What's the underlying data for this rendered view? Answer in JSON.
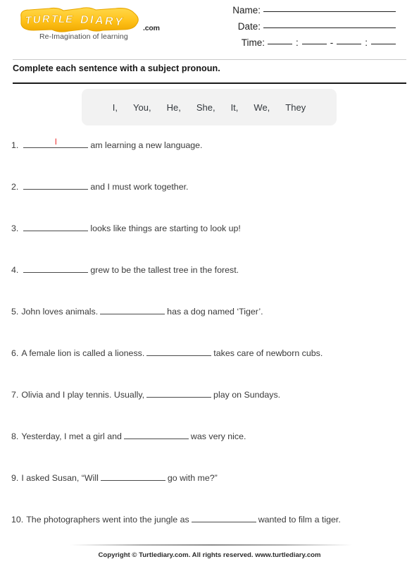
{
  "brand": {
    "logo_text": "TURTLE DIARY",
    "logo_word_1": "TURTLE",
    "logo_word_2": "DIARY",
    "dotcom": ".com",
    "tagline": "Re-Imagination of learning",
    "logo_fill_color": "#FFC81E",
    "logo_stroke_color": "#E8A600",
    "logo_letter_color": "#FFFFFF"
  },
  "header": {
    "name_label": "Name:",
    "date_label": "Date:",
    "time_label": "Time:",
    "time_sep_1": ":",
    "time_sep_2": "-",
    "time_sep_3": ":"
  },
  "instruction": "Complete each sentence with a subject pronoun.",
  "wordbank": {
    "words": [
      "I,",
      "You,",
      "He,",
      "She,",
      "It,",
      "We,",
      "They"
    ],
    "background_color": "#f2f2f2"
  },
  "answer_color": "#ee3b3b",
  "questions": [
    {
      "num": "1.",
      "before": "",
      "after": "am learning a new language.",
      "answer": "I"
    },
    {
      "num": "2.",
      "before": "",
      "after": "and I must work together.",
      "answer": ""
    },
    {
      "num": "3.",
      "before": "",
      "after": "looks like things are starting to look up!",
      "answer": ""
    },
    {
      "num": "4.",
      "before": "",
      "after": "grew to be the tallest tree in the forest.",
      "answer": ""
    },
    {
      "num": "5.",
      "before": "John loves animals.",
      "after": "has a dog named ‘Tiger’.",
      "answer": ""
    },
    {
      "num": "6.",
      "before": "A female lion is called a lioness.",
      "after": "takes care of newborn cubs.",
      "answer": ""
    },
    {
      "num": "7.",
      "before": "Olivia and I play tennis. Usually,",
      "after": "play on Sundays.",
      "answer": ""
    },
    {
      "num": "8.",
      "before": "Yesterday, I met a girl and",
      "after": "was very nice.",
      "answer": ""
    },
    {
      "num": "9.",
      "before": "I asked Susan, “Will",
      "after": "go with me?”",
      "answer": ""
    },
    {
      "num": "10.",
      "before": "The photographers went into the jungle as",
      "after": "wanted to film a tiger.",
      "answer": ""
    }
  ],
  "footer": {
    "copyright": "Copyright © Turtlediary.com. All rights reserved. www.turtlediary.com"
  }
}
